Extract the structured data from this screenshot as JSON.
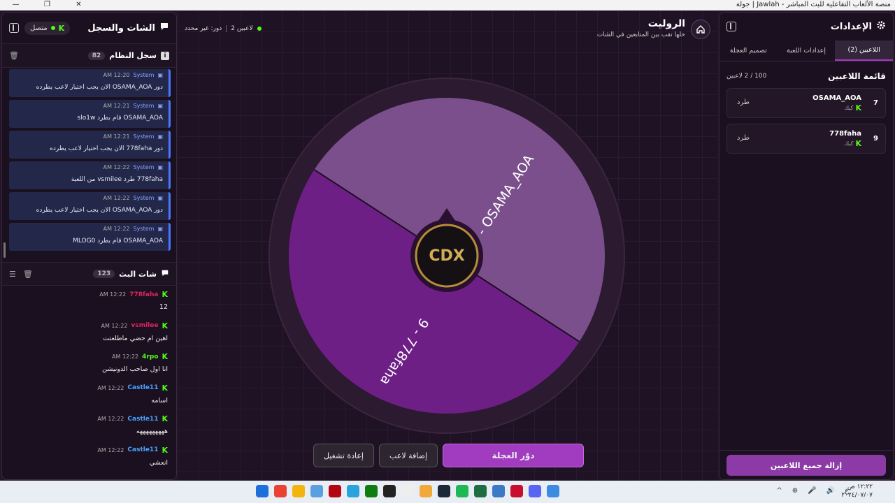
{
  "window": {
    "title": "منصة الألعاب التفاعلية للبث المباشر - Jawlah | جولة",
    "controls": [
      "—",
      "❐",
      "✕"
    ]
  },
  "chat_panel": {
    "title": "الشات والسجل",
    "status": "متصل",
    "system_log": {
      "title": "سجل النظام",
      "count": "82",
      "messages": [
        {
          "sender": "System",
          "time": "12:20 AM",
          "text": "دور OSAMA_AOA الان يجب اختيار لاعب يطرده"
        },
        {
          "sender": "System",
          "time": "12:21 AM",
          "text": "OSAMA_AOA قام بطرد slo1w"
        },
        {
          "sender": "System",
          "time": "12:21 AM",
          "text": "دور 778faha الان يجب اختيار لاعب يطرده"
        },
        {
          "sender": "System",
          "time": "12:22 AM",
          "text": "778faha طرد vsmilee من اللعبة"
        },
        {
          "sender": "System",
          "time": "12:22 AM",
          "text": "دور OSAMA_AOA الان يجب اختيار لاعب يطرده"
        },
        {
          "sender": "System",
          "time": "12:22 AM",
          "text": "OSAMA_AOA قام بطرد MLOG0"
        }
      ]
    },
    "stream_chat": {
      "title": "شات البث",
      "count": "123",
      "messages": [
        {
          "user": "778faha",
          "color": "#e0245e",
          "time": "12:22 AM",
          "text": "12"
        },
        {
          "user": "vsmilee",
          "color": "#e0245e",
          "time": "12:22 AM",
          "text": "اهين ام حضي ماطلعتت"
        },
        {
          "user": "4rpo",
          "color": "#53fc18",
          "time": "12:22 AM",
          "text": "انا اول صاحب الدونيشن"
        },
        {
          "user": "Castle11",
          "color": "#4aa3ff",
          "time": "12:22 AM",
          "text": "اسامه"
        },
        {
          "user": "Castle11",
          "color": "#4aa3ff",
          "time": "12:22 AM",
          "text": "هههههههههه"
        },
        {
          "user": "Castle11",
          "color": "#4aa3ff",
          "time": "12:22 AM",
          "text": "انعشي"
        }
      ]
    }
  },
  "center": {
    "title": "الرولیت",
    "subtitle": "خلها تقب بين المتابعين في الشات",
    "players_count": "2 لاعبين",
    "turn": "دور: غير محدد",
    "wheel": {
      "segments": [
        {
          "label": "7 - OSAMA_AOA",
          "color": "#7b4f8c"
        },
        {
          "label": "9 - 778faha",
          "color": "#6e1f86"
        }
      ],
      "center_logo": "CDX",
      "rim_color": "#2c1a31"
    },
    "buttons": {
      "spin": "دوّر العجلة",
      "add_player": "إضافة لاعب",
      "restart": "إعادة تشغيل"
    }
  },
  "settings_panel": {
    "title": "الإعدادات",
    "tabs": [
      "اللاعبين (2)",
      "إعدادات اللعبة",
      "تصميم العجلة"
    ],
    "players_list_title": "قائمة اللاعبين",
    "players_count": "100 / 2 لاعبين",
    "players": [
      {
        "num": "7",
        "name": "OSAMA_AOA",
        "platform": "كيك",
        "kick": "طرد"
      },
      {
        "num": "9",
        "name": "778faha",
        "platform": "كيك",
        "kick": "طرد"
      }
    ],
    "remove_all": "إزالة جميع اللاعبين"
  },
  "taskbar": {
    "icons": [
      "windows-icon",
      "chrome-icon",
      "files-icon",
      "bird-icon",
      "netflix-icon",
      "telegram-icon",
      "xbox-icon",
      "obs-icon",
      "chat-icon",
      "hello-icon",
      "steam-icon",
      "spotify-icon",
      "excel-icon",
      "app-icon",
      "game-icon",
      "discord-icon",
      "notes-icon"
    ],
    "icon_colors": [
      "#1e6fd9",
      "#e94235",
      "#f2b50f",
      "#5aa0e0",
      "#b20710",
      "#2aa3dd",
      "#107c10",
      "#222222",
      "#eeeeee",
      "#f2a93b",
      "#1b2838",
      "#1db954",
      "#1d6f42",
      "#3b78c6",
      "#c8102e",
      "#5865f2",
      "#3d8be0"
    ],
    "tray": [
      "^",
      "⊕",
      "🎤",
      "🔊",
      "ع"
    ],
    "time": "١٢:٢٢ ص",
    "date": "٢٠٢٤/٠٧/٠٧"
  }
}
